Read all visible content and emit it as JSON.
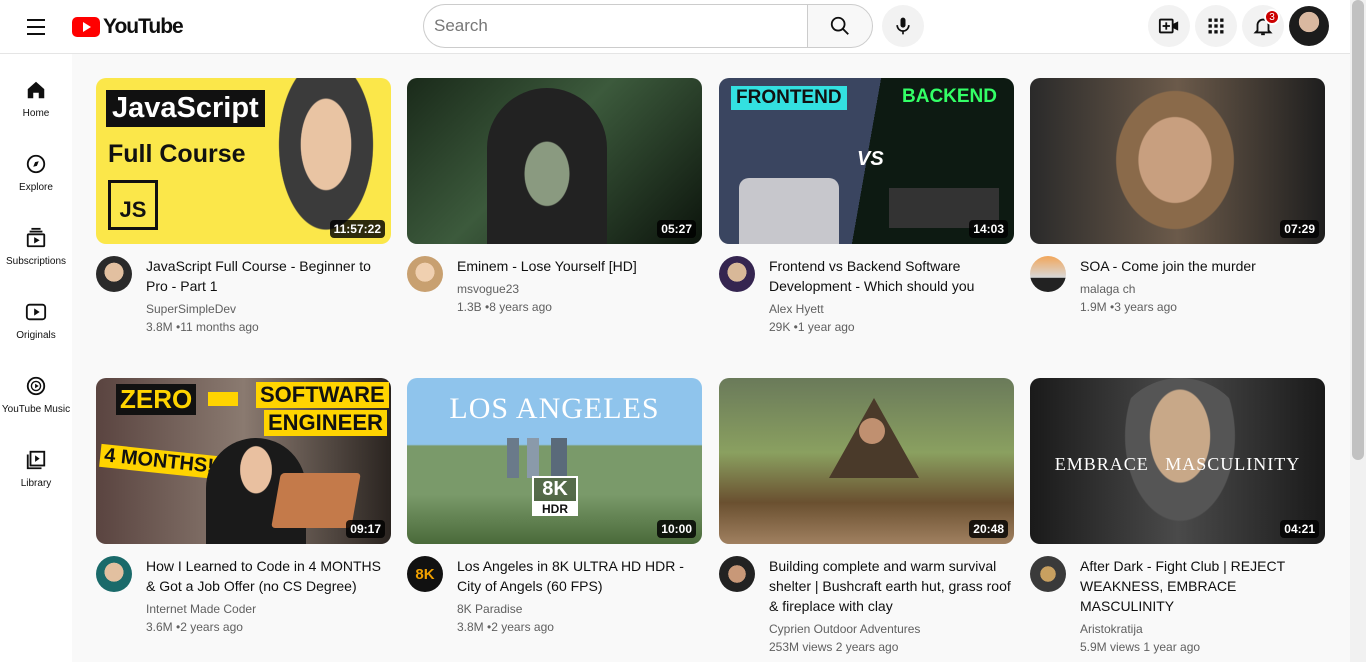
{
  "header": {
    "logo_text": "YouTube",
    "search_placeholder": "Search",
    "notification_count": "3"
  },
  "sidebar": {
    "items": [
      {
        "label": "Home",
        "icon": "home-icon"
      },
      {
        "label": "Explore",
        "icon": "compass-icon"
      },
      {
        "label": "Subscriptions",
        "icon": "subscriptions-icon"
      },
      {
        "label": "Originals",
        "icon": "originals-icon"
      },
      {
        "label": "YouTube Music",
        "icon": "music-icon"
      },
      {
        "label": "Library",
        "icon": "library-icon"
      }
    ]
  },
  "videos": [
    {
      "title": "JavaScript Full Course - Beginner to Pro - Part 1",
      "channel": "SuperSimpleDev",
      "stats": "3.8M •11 months ago",
      "duration": "11:57:22",
      "thumb_text": [
        "JavaScript",
        "Full Course",
        "JS"
      ]
    },
    {
      "title": "Eminem - Lose Yourself [HD]",
      "channel": "msvogue23",
      "stats": "1.3B •8 years ago",
      "duration": "05:27"
    },
    {
      "title": "Frontend vs Backend Software Development - Which should you",
      "channel": "Alex Hyett",
      "stats": "29K •1 year ago",
      "duration": "14:03",
      "thumb_text": [
        "FRONTEND",
        "BACKEND",
        "VS"
      ]
    },
    {
      "title": "SOA - Come join the murder",
      "channel": "malaga ch",
      "stats": "1.9M •3 years ago",
      "duration": "07:29"
    },
    {
      "title": "How I Learned to Code in 4 MONTHS & Got a Job Offer (no CS Degree)",
      "channel": "Internet Made Coder",
      "stats": "3.6M •2 years ago",
      "duration": "09:17",
      "thumb_text": [
        "ZERO",
        "SOFTWARE",
        "ENGINEER",
        "4 MONTHS!"
      ]
    },
    {
      "title": "Los Angeles in 8K ULTRA HD HDR - City of Angels (60 FPS)",
      "channel": "8K Paradise",
      "stats": "3.8M •2 years ago",
      "duration": "10:00",
      "thumb_text": [
        "LOS ANGELES",
        "8K",
        "HDR"
      ]
    },
    {
      "title": "Building complete and warm survival shelter | Bushcraft earth hut, grass roof & fireplace with clay",
      "channel": "Cyprien Outdoor Adventures",
      "stats": "253M views 2 years ago",
      "duration": "20:48"
    },
    {
      "title": "After Dark - Fight Club | REJECT WEAKNESS, EMBRACE MASCULINITY",
      "channel": "Aristokratija",
      "stats": "5.9M views 1 year ago",
      "duration": "04:21",
      "thumb_text": [
        "EMBRACE   MASCULINITY"
      ]
    }
  ]
}
